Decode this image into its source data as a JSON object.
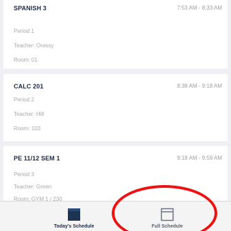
{
  "classes": [
    {
      "title": "SPANISH 3",
      "time": "7:53 AM - 8:33 AM",
      "period": "Period 1",
      "teacher": "Teacher: Orassy",
      "room": "Room: 01"
    },
    {
      "title": "CALC 201",
      "time": "8:38 AM - 9:18 AM",
      "period": "Period 2",
      "teacher": "Teacher: Hill",
      "room": "Room: 103"
    },
    {
      "title": "PE 11/12 SEM 1",
      "time": "9:18 AM - 9:59 AM",
      "period": "Period 3",
      "teacher": "Teacher: Green",
      "room": "Room: GYM 1 / 230"
    }
  ],
  "tabbar": {
    "today_label": "Today's Schedule",
    "full_label": "Full Schedule",
    "today_icon": "calendar-filled-icon",
    "full_icon": "calendar-outline-icon"
  },
  "colors": {
    "title": "#1d2a44",
    "muted": "#a6a9ad",
    "annotation": "#ee1111"
  }
}
